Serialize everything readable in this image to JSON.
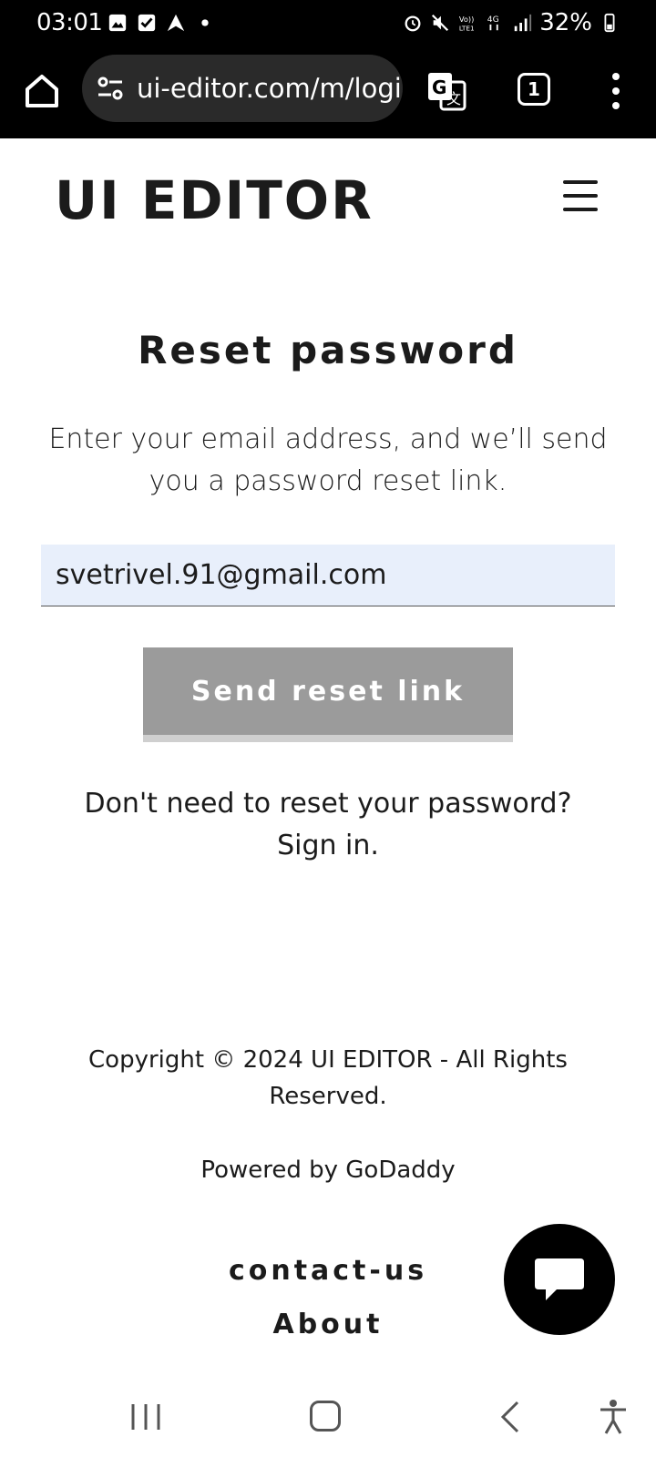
{
  "status_bar": {
    "time": "03:01",
    "battery": "32%",
    "icons": [
      "gallery-icon",
      "check-icon",
      "arrow-icon",
      "dot-icon",
      "alarm-icon",
      "mute-icon",
      "volte-icon",
      "4g-icon",
      "signal-icon",
      "battery-icon"
    ]
  },
  "browser": {
    "url": "ui-editor.com/m/logi",
    "tab_count": "1"
  },
  "site": {
    "logo": "UI EDITOR"
  },
  "page": {
    "title": "Reset password",
    "description": "Enter your email address, and we’ll send you a password reset link.",
    "email_value": "svetrivel.91@gmail.com",
    "send_button": "Send reset link",
    "signin_prompt": "Don't need to reset your password?",
    "signin_link": "Sign in."
  },
  "footer": {
    "copyright": "Copyright © 2024 UI EDITOR - All Rights Reserved.",
    "powered": "Powered by GoDaddy",
    "contact": "contact-us",
    "about": "About"
  },
  "colors": {
    "button_bg": "#9b9b9b",
    "input_bg": "#e8effb",
    "fab_bg": "#000000"
  }
}
